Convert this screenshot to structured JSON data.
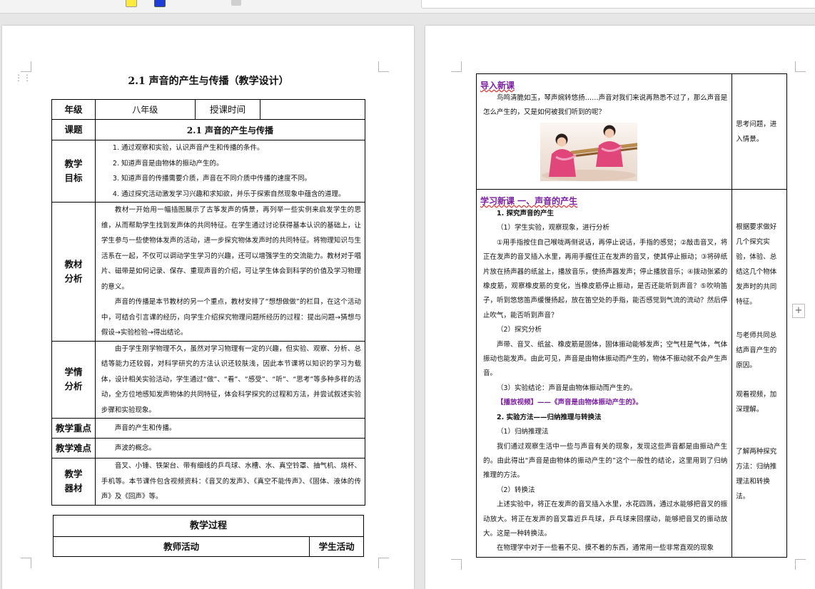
{
  "left_page": {
    "title": "2.1 声音的产生与传播（教学设计）",
    "grade_label": "年级",
    "grade_value": "八年级",
    "time_label": "授课时间",
    "time_value": "",
    "topic_label": "课题",
    "topic_value": "2.1 声音的产生与传播",
    "goals_label": "教学目标",
    "goals": [
      "1. 通过观察和实验，认识声音产生和传播的条件。",
      "2. 知道声音是由物体的振动产生的。",
      "3. 知道声音的传播需要介质，声音在不同介质中传播的速度不同。",
      "4. 通过探究活动激发学习兴趣和求知欲，并乐于探索自然现象中蕴含的道理。"
    ],
    "material_label": "教材分析",
    "material": [
      "教材一开始用一幅插图展示了古筝发声的情景，再列举一些实例来启发学生的思维，从而帮助学生找到发声体的共同特征。在学生通过讨论获得基本认识的基础上，让学生参与一些使物体发声的活动，进一步探究物体发声时的共同特征。将物理知识与生活系在一起，不仅可以调动学生学习的兴趣，还可以增强学生的交流能力。教材对于唱片、磁带是如何记录、保存、重现声音的介绍，可让学生体会到科学的价值及学习物理的意义。",
      "声音的传播是本节教材的另一个重点，教材安排了“想想做做”的栏目，在这个活动中，可结合引言课的经历，向学生介绍探究物理问题所经历的过程：提出问题→猜想与假设→实验检验→得出结论。"
    ],
    "students_label": "学情分析",
    "students": "由于学生刚学物理不久，虽然对学习物理有一定的兴趣，但实验、观察、分析、总结等能力还较弱，对科学研究的方法认识还较肤浅，因此本节课将以知识的学习为载体，设计相关实验活动，学生通过“做”、“看”、“感受”、“听”、“思考”等多种多样的活动，全方位地感知发声物体的共同特征，体会科学探究的过程和方法，并尝试叙述实验步骤和实验现象。",
    "key_label": "教学重点",
    "key_value": "声音的产生和传播。",
    "difficulty_label": "教学难点",
    "difficulty_value": "声波的概念。",
    "equipment_label": "教学器材",
    "equipment": "音叉、小锤、铁架台、带有细线的乒乓球、水槽、水、真空铃罩、抽气机、烧杯、手机等。本节课件包含视频资料：《音叉的发声》、《真空不能传声》、《固体、液体的传声》及《回声》等。",
    "process_label": "教学过程",
    "teacher_label": "教师活动",
    "student_label": "学生活动"
  },
  "right_page": {
    "intro_heading": "导入新课",
    "intro_text": "鸟鸣清脆如玉，琴声婉转悠扬……声音对我们来说再熟悉不过了，那么声音是怎么产生的，又是如何被我们听到的呢？",
    "intro_side": "思考问题，进入情景。",
    "new_heading": "学习新课 一、声音的产生",
    "new_lines": [
      {
        "text": "1. 探究声音的产生",
        "style": "b"
      },
      {
        "text": "（1）学生实验，观察现象，进行分析",
        "style": ""
      },
      {
        "text": "①用手指按住自己喉咙两侧说话，再停止说话，手指的感觉；②敲击音叉，将正在发声的音叉插入水里，再用手握住正在发声的音叉，使其停止振动；③将碎纸片放在扬声器的纸盆上，播放音乐，使扬声器发声；停止播放音乐；④拨动张紧的橡皮筋，观察橡皮筋的变化，当橡皮筋停止振动，是否还能听到声音？⑤吹响笛子，听到悠悠笛声缓慢扬起，放在笛空处的手指，能否感觉到气流的流动？然后停止吹气，能否听到声音？",
        "style": ""
      },
      {
        "text": "（2）探究分析",
        "style": ""
      },
      {
        "text": "声带、音叉、纸盆、橡皮筋是固体，固体振动能够发声；空气柱是气体，气体振动也能发声。由此可见，声音是由物体振动而产生的，物体不振动就不会产生声音。",
        "style": ""
      },
      {
        "text": "（3）实验结论：声音是由物体振动而产生的。",
        "style": ""
      },
      {
        "text": "【播放视频】——《声音是由物体振动产生的》。",
        "style": "vid"
      },
      {
        "text": "2. 实验方法——归纳推理与转换法",
        "style": "b"
      },
      {
        "text": "（1）归纳推理法",
        "style": ""
      },
      {
        "text": "我们通过观察生活中一些与声音有关的现象，发现这些声音都是由振动产生的。由此得出“声音是由物体的振动产生的”这个一般性的结论，这里用到了归纳推理的方法。",
        "style": ""
      },
      {
        "text": "（2）转换法",
        "style": ""
      },
      {
        "text": "上述实验中，将正在发声的音叉插入水里，水花四溅，通过水能够把音叉的振动放大。将正在发声的音叉靠近乒乓球，乒乓球来回摆动，能够把音叉的振动放大。这是一种转换法。",
        "style": ""
      },
      {
        "text": "在物理学中对于一些看不见、摸不着的东西，通常用一些非常直观的现象",
        "style": ""
      }
    ],
    "side_notes": [
      "根据要求做好几个探究实验，体验、总结这几个物体发声时的共同特征。",
      "与老师共同总结声音产生的原因。",
      "观看视频，加深理解。",
      "了解两种探究方法：归纳推理法和转换法。"
    ]
  },
  "ui": {
    "add_comment_icon": "plus-icon",
    "drag_handle_icon": "drag-handle-icon"
  }
}
